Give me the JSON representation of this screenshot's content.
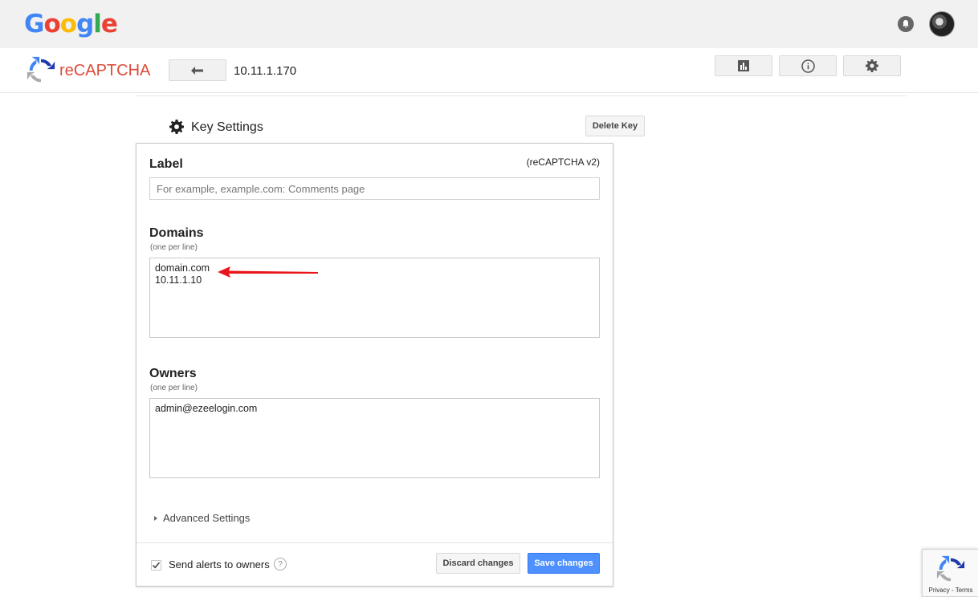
{
  "google_bar": {
    "logo_letters": [
      "G",
      "o",
      "o",
      "g",
      "l",
      "e"
    ]
  },
  "header": {
    "product_name": "reCAPTCHA",
    "site_name": "10.11.1.170",
    "colors": {
      "brand_red": "#dd4b39"
    }
  },
  "key_settings": {
    "title": "Key Settings",
    "delete_label": "Delete Key",
    "version": "(reCAPTCHA v2)",
    "label": {
      "title": "Label",
      "value": "",
      "placeholder": "For example, example.com: Comments page"
    },
    "domains": {
      "title": "Domains",
      "hint": "(one per line)",
      "value": "domain.com\n10.11.1.10"
    },
    "owners": {
      "title": "Owners",
      "hint": "(one per line)",
      "value": "admin@ezeelogin.com"
    },
    "advanced_label": "Advanced Settings",
    "alerts_label": "Send alerts to owners",
    "alerts_checked": true,
    "help_glyph": "?",
    "discard_label": "Discard changes",
    "save_label": "Save changes",
    "colors": {
      "save_blue": "#4d90fe",
      "annotation_arrow": "#e8151b"
    }
  },
  "badge": {
    "privacy": "Privacy",
    "separator": " - ",
    "terms": "Terms"
  }
}
